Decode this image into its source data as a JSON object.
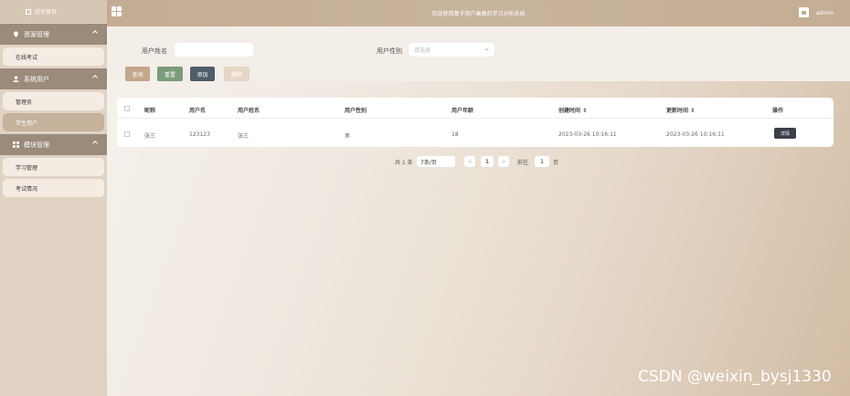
{
  "sidebar": {
    "home_label": "后台首页",
    "groups": [
      {
        "label": "资源管理",
        "items": [
          "在线考试"
        ]
      },
      {
        "label": "系统用户",
        "items": [
          "管理员",
          "学生用户"
        ]
      },
      {
        "label": "模块管理",
        "items": [
          "学习管理",
          "考试情况"
        ]
      }
    ],
    "active_item": "学生用户"
  },
  "header": {
    "welcome": "欢迎使用基于用户画像的学习分析系统",
    "user": "admin"
  },
  "search": {
    "name_label": "用户姓名",
    "name_value": "",
    "gender_label": "用户性别",
    "gender_placeholder": "请选择"
  },
  "buttons": {
    "query": "查询",
    "reset": "重置",
    "add": "添加",
    "delete": "删除"
  },
  "table": {
    "headers": [
      "昵称",
      "用户名",
      "用户姓名",
      "用户性别",
      "用户年龄",
      "创建时间 ⇕",
      "更新时间 ⇕",
      "操作"
    ],
    "rows": [
      [
        "张三",
        "123123",
        "张三",
        "男",
        "18",
        "2023-03-26 10:16:11",
        "2023-03-26 10:16:11",
        "详情"
      ]
    ]
  },
  "pagination": {
    "total": "共 1 条",
    "page_size": "7条/页",
    "prev": "<",
    "current": "1",
    "next": ">",
    "goto_label": "前往",
    "goto_value": "1",
    "page_suffix": "页"
  },
  "watermark": "CSDN @weixin_bysj1330",
  "colors": {
    "query_btn": "#c3a78c",
    "reset_btn": "#7c9b7a",
    "add_btn": "#505c6a",
    "delete_btn": "#e6d6c6"
  }
}
